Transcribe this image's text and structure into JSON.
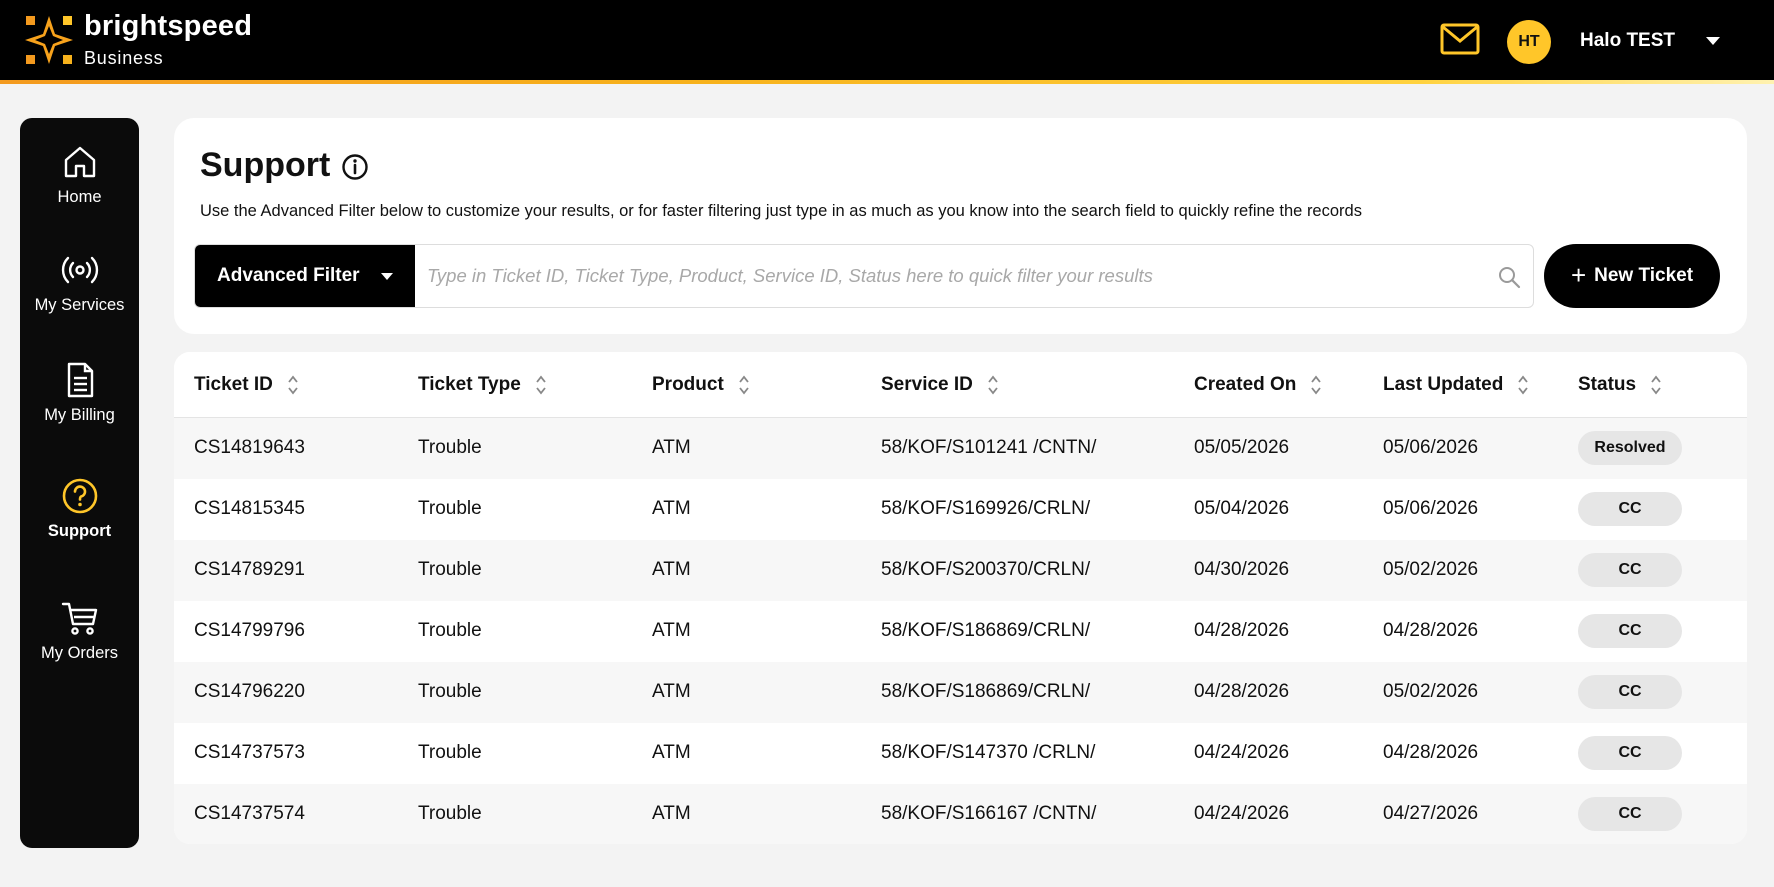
{
  "header": {
    "brand_name": "brightspeed",
    "brand_sub": "Business",
    "user_initials": "HT",
    "user_name": "Halo TEST",
    "icons": {
      "mail": "mail-icon",
      "caret": "chevron-down-icon"
    },
    "colors": {
      "accent": "#ffc629",
      "brand_orange": "#f39a1e"
    }
  },
  "sidebar": {
    "items": [
      {
        "label": "Home",
        "icon": "home-icon",
        "active": false
      },
      {
        "label": "My Services",
        "icon": "broadcast-icon",
        "active": false
      },
      {
        "label": "My Billing",
        "icon": "document-icon",
        "active": false
      },
      {
        "label": "Support",
        "icon": "help-circle-icon",
        "active": true
      },
      {
        "label": "My Orders",
        "icon": "cart-icon",
        "active": false
      }
    ]
  },
  "support": {
    "title": "Support",
    "description": "Use the Advanced Filter below to customize your results, or for faster filtering just type in as much as you know into the search field to quickly refine the records",
    "advanced_filter_label": "Advanced Filter",
    "search_placeholder": "Type in Ticket ID, Ticket Type, Product, Service ID, Status here to quick filter your results",
    "new_ticket_label": "New Ticket"
  },
  "table": {
    "columns": [
      "Ticket ID",
      "Ticket Type",
      "Product",
      "Service ID",
      "Created On",
      "Last Updated",
      "Status"
    ],
    "rows": [
      [
        "CS14819643",
        "Trouble",
        "ATM",
        "58/KOF/S101241 /CNTN/",
        "05/05/2026",
        "05/06/2026",
        "Resolved"
      ],
      [
        "CS14815345",
        "Trouble",
        "ATM",
        "58/KOF/S169926/CRLN/",
        "05/04/2026",
        "05/06/2026",
        "CC"
      ],
      [
        "CS14789291",
        "Trouble",
        "ATM",
        "58/KOF/S200370/CRLN/",
        "04/30/2026",
        "05/02/2026",
        "CC"
      ],
      [
        "CS14799796",
        "Trouble",
        "ATM",
        "58/KOF/S186869/CRLN/",
        "04/28/2026",
        "04/28/2026",
        "CC"
      ],
      [
        "CS14796220",
        "Trouble",
        "ATM",
        "58/KOF/S186869/CRLN/",
        "04/28/2026",
        "05/02/2026",
        "CC"
      ],
      [
        "CS14737573",
        "Trouble",
        "ATM",
        "58/KOF/S147370 /CRLN/",
        "04/24/2026",
        "04/28/2026",
        "CC"
      ],
      [
        "CS14737574",
        "Trouble",
        "ATM",
        "58/KOF/S166167 /CNTN/",
        "04/24/2026",
        "04/27/2026",
        "CC"
      ]
    ]
  }
}
